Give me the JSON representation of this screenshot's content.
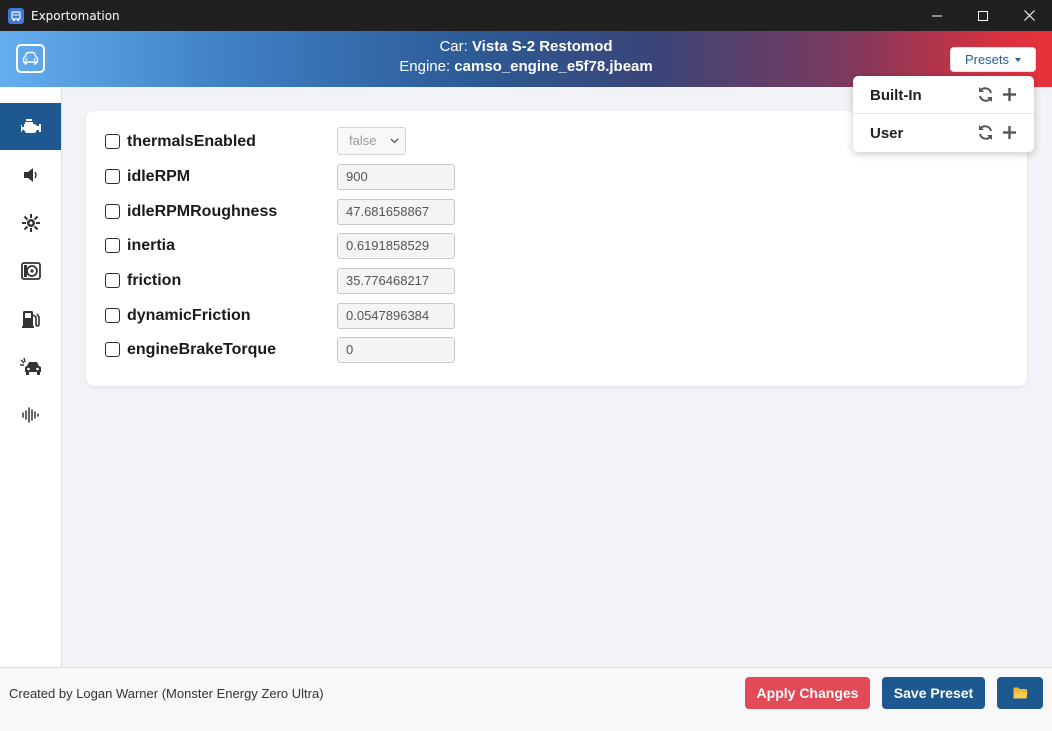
{
  "window": {
    "title": "Exportomation"
  },
  "header": {
    "car_prefix": "Car: ",
    "car_name": "Vista S-2 Restomod",
    "engine_prefix": "Engine: ",
    "engine_file": "camso_engine_e5f78.jbeam",
    "presets_label": "Presets"
  },
  "sidebar": {
    "items": [
      {
        "icon": "engine-icon",
        "active": true
      },
      {
        "icon": "speaker-icon",
        "active": false
      },
      {
        "icon": "turbo-icon",
        "active": false
      },
      {
        "icon": "supercharger-icon",
        "active": false
      },
      {
        "icon": "fuel-pump-icon",
        "active": false
      },
      {
        "icon": "car-crash-icon",
        "active": false
      },
      {
        "icon": "waveform-icon",
        "active": false
      }
    ]
  },
  "params": [
    {
      "name": "thermalsEnabled",
      "type": "select",
      "value": "false",
      "checked": false
    },
    {
      "name": "idleRPM",
      "type": "input",
      "value": "900",
      "checked": false
    },
    {
      "name": "idleRPMRoughness",
      "type": "input",
      "value": "47.681658867",
      "checked": false
    },
    {
      "name": "inertia",
      "type": "input",
      "value": "0.6191858529",
      "checked": false
    },
    {
      "name": "friction",
      "type": "input",
      "value": "35.776468217",
      "checked": false
    },
    {
      "name": "dynamicFriction",
      "type": "input",
      "value": "0.0547896384",
      "checked": false
    },
    {
      "name": "engineBrakeTorque",
      "type": "input",
      "value": "0",
      "checked": false
    }
  ],
  "presets_menu": {
    "items": [
      {
        "label": "Built-In"
      },
      {
        "label": "User"
      }
    ]
  },
  "footer": {
    "credit": "Created by Logan Warner (Monster Energy Zero Ultra)",
    "apply_label": "Apply Changes",
    "save_label": "Save Preset"
  },
  "colors": {
    "accent_blue": "#1d5891",
    "apply_red": "#e24a57",
    "folder_yellow": "#f2b630"
  }
}
